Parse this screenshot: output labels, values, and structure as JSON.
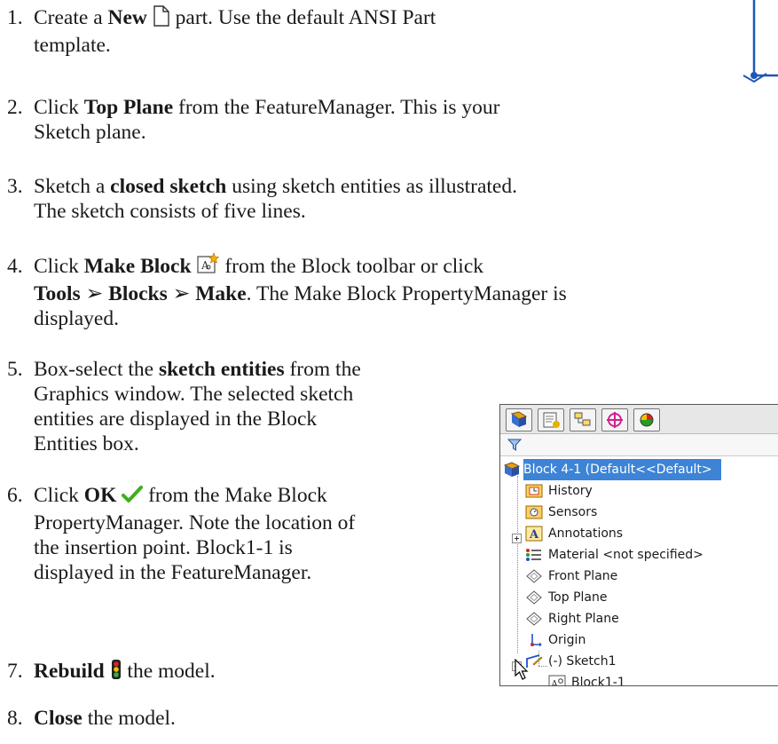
{
  "steps": [
    {
      "num": "1.",
      "t1_a": "Create a ",
      "t1_b": "New",
      "t1_c": " part. Use the default ANSI Part",
      "t2": "template."
    },
    {
      "num": "2.",
      "t1_a": "Click ",
      "t1_b": "Top Plane",
      "t1_c": " from the FeatureManager. This is your",
      "t2": "Sketch plane."
    },
    {
      "num": "3.",
      "t1_a": "Sketch a ",
      "t1_b": "closed sketch",
      "t1_c": " using sketch entities as illustrated.",
      "t2": "The sketch consists of five lines."
    },
    {
      "num": "4.",
      "t1_a": "Click ",
      "t1_b": "Make Block",
      "t1_c": " from the Block toolbar or click",
      "t2_b1": "Tools",
      "t2_sep1": " ➢ ",
      "t2_b2": "Blocks",
      "t2_sep2": " ➢ ",
      "t2_b3": "Make",
      "t2_c": ". The Make Block PropertyManager is",
      "t3": "displayed."
    },
    {
      "num": "5.",
      "t1_a": "Box-select the ",
      "t1_b": "sketch entities",
      "t1_c": " from the",
      "t2": "Graphics window. The selected sketch",
      "t3": "entities are displayed in the Block",
      "t4": "Entities box."
    },
    {
      "num": "6.",
      "t1_a": "Click ",
      "t1_b": "OK",
      "t1_c": " from the Make Block",
      "t2": "PropertyManager. Note the location of",
      "t3": "the insertion point. Block1-1 is",
      "t4": "displayed in the FeatureManager."
    },
    {
      "num": "7.",
      "t1_b": "Rebuild",
      "t1_c": " the model."
    },
    {
      "num": "8.",
      "t1_b": "Close",
      "t1_c": " the model."
    }
  ],
  "tree": {
    "root": "Block 4-1  (Default<<Default>",
    "items": [
      "History",
      "Sensors",
      "Annotations",
      "Material <not specified>",
      "Front Plane",
      "Top Plane",
      "Right Plane",
      "Origin",
      "(-) Sketch1",
      "Block1-1"
    ]
  },
  "icons": {
    "new_doc": "new-document-icon",
    "make_block": "make-block-icon",
    "ok_check": "green-checkmark-icon",
    "rebuild": "traffic-light-icon"
  }
}
